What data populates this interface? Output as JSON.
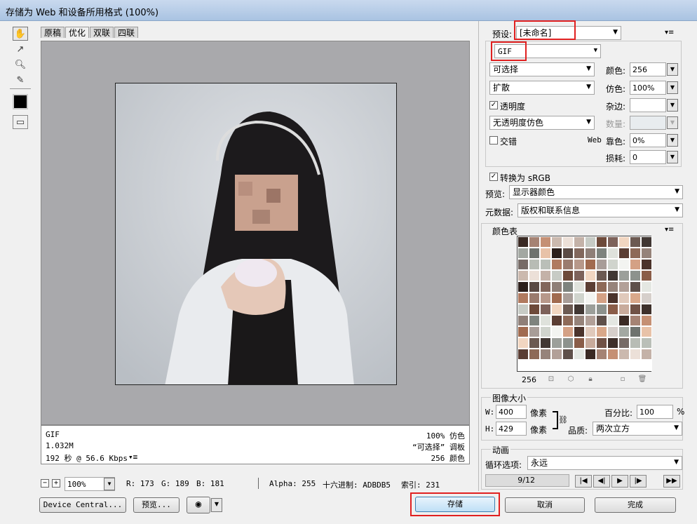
{
  "window": {
    "title": "存储为 Web 和设备所用格式 (100%)"
  },
  "view_tabs": [
    "原稿",
    "优化",
    "双联",
    "四联"
  ],
  "info_left": [
    "GIF",
    "1.032M",
    "192 秒 @ 56.6 Kbps"
  ],
  "info_right": [
    "100% 仿色",
    "“可选择” 调板",
    "256 颜色"
  ],
  "preset": {
    "label": "预设:",
    "value": "[未命名]"
  },
  "format": {
    "value": "GIF"
  },
  "settings": {
    "reduction": "可选择",
    "colors_label": "颜色:",
    "colors_value": "256",
    "dither_algo": "扩散",
    "dither_label": "仿色:",
    "dither_value": "100%",
    "transparency_label": "透明度",
    "matte_label": "杂边:",
    "trans_dither": "无透明度仿色",
    "amount_label": "数量:",
    "interlaced_label": "交错",
    "websnap_label_a": "Web",
    "websnap_label_b": "靠色:",
    "websnap_value": "0%",
    "lossy_label": "损耗:",
    "lossy_value": "0"
  },
  "srgb": {
    "label": "转换为 sRGB"
  },
  "preview_row": {
    "label": "预览:",
    "value": "显示器颜色"
  },
  "metadata_row": {
    "label": "元数据:",
    "value": "版权和联系信息"
  },
  "color_table": {
    "title": "颜色表",
    "count": "256"
  },
  "image_size": {
    "title": "图像大小",
    "w_label": "W:",
    "w_value": "400",
    "w_unit": "像素",
    "h_label": "H:",
    "h_value": "429",
    "h_unit": "像素",
    "percent_label": "百分比:",
    "percent_value": "100",
    "percent_unit": "%",
    "quality_label": "品质:",
    "quality_value": "两次立方"
  },
  "animation": {
    "title": "动画",
    "loop_label": "循环选项:",
    "loop_value": "永远",
    "frame": "9/12"
  },
  "statusbar": {
    "minus": "−",
    "plus": "+",
    "zoom": "100%",
    "r": "R: 173",
    "g": "G: 189",
    "b": "B: 181",
    "alpha": "Alpha: 255",
    "hex": "十六进制: ADBDB5",
    "index": "索引: 231"
  },
  "buttons": {
    "device_central": "Device Central...",
    "preview": "预览...",
    "save": "存储",
    "cancel": "取消",
    "done": "完成"
  },
  "swatch_colors": [
    "#3a2a24",
    "#6d4a3a",
    "#8a5d48",
    "#b07a5f",
    "#d4a185",
    "#e8c2a8",
    "#5b3e34",
    "#a58374",
    "#7d625a",
    "#c8ab9c",
    "#9a7b6e",
    "#4b332b",
    "#2c1f1b",
    "#8e6a58",
    "#c59074",
    "#f1d6c1",
    "#705246",
    "#b7988a",
    "#e0c9bb",
    "#5a4a44",
    "#96837a",
    "#cbb9ae",
    "#6c5a52",
    "#3e302b",
    "#a16b50",
    "#d9a88a",
    "#82675c",
    "#b2a098",
    "#ece0d8",
    "#413733",
    "#776b66",
    "#a89d98",
    "#d6cfcb",
    "#8f7f78",
    "#5f504a",
    "#c4b2a8",
    "#9c9f9a",
    "#b8bcb5",
    "#d0d4cd",
    "#a3a8a2",
    "#7e837e",
    "#e4e7e2",
    "#c7cbc5",
    "#8d928d",
    "#babfb8",
    "#f3f4f1",
    "#6f736f",
    "#dfe2dc"
  ],
  "accent_red": "#e02020"
}
